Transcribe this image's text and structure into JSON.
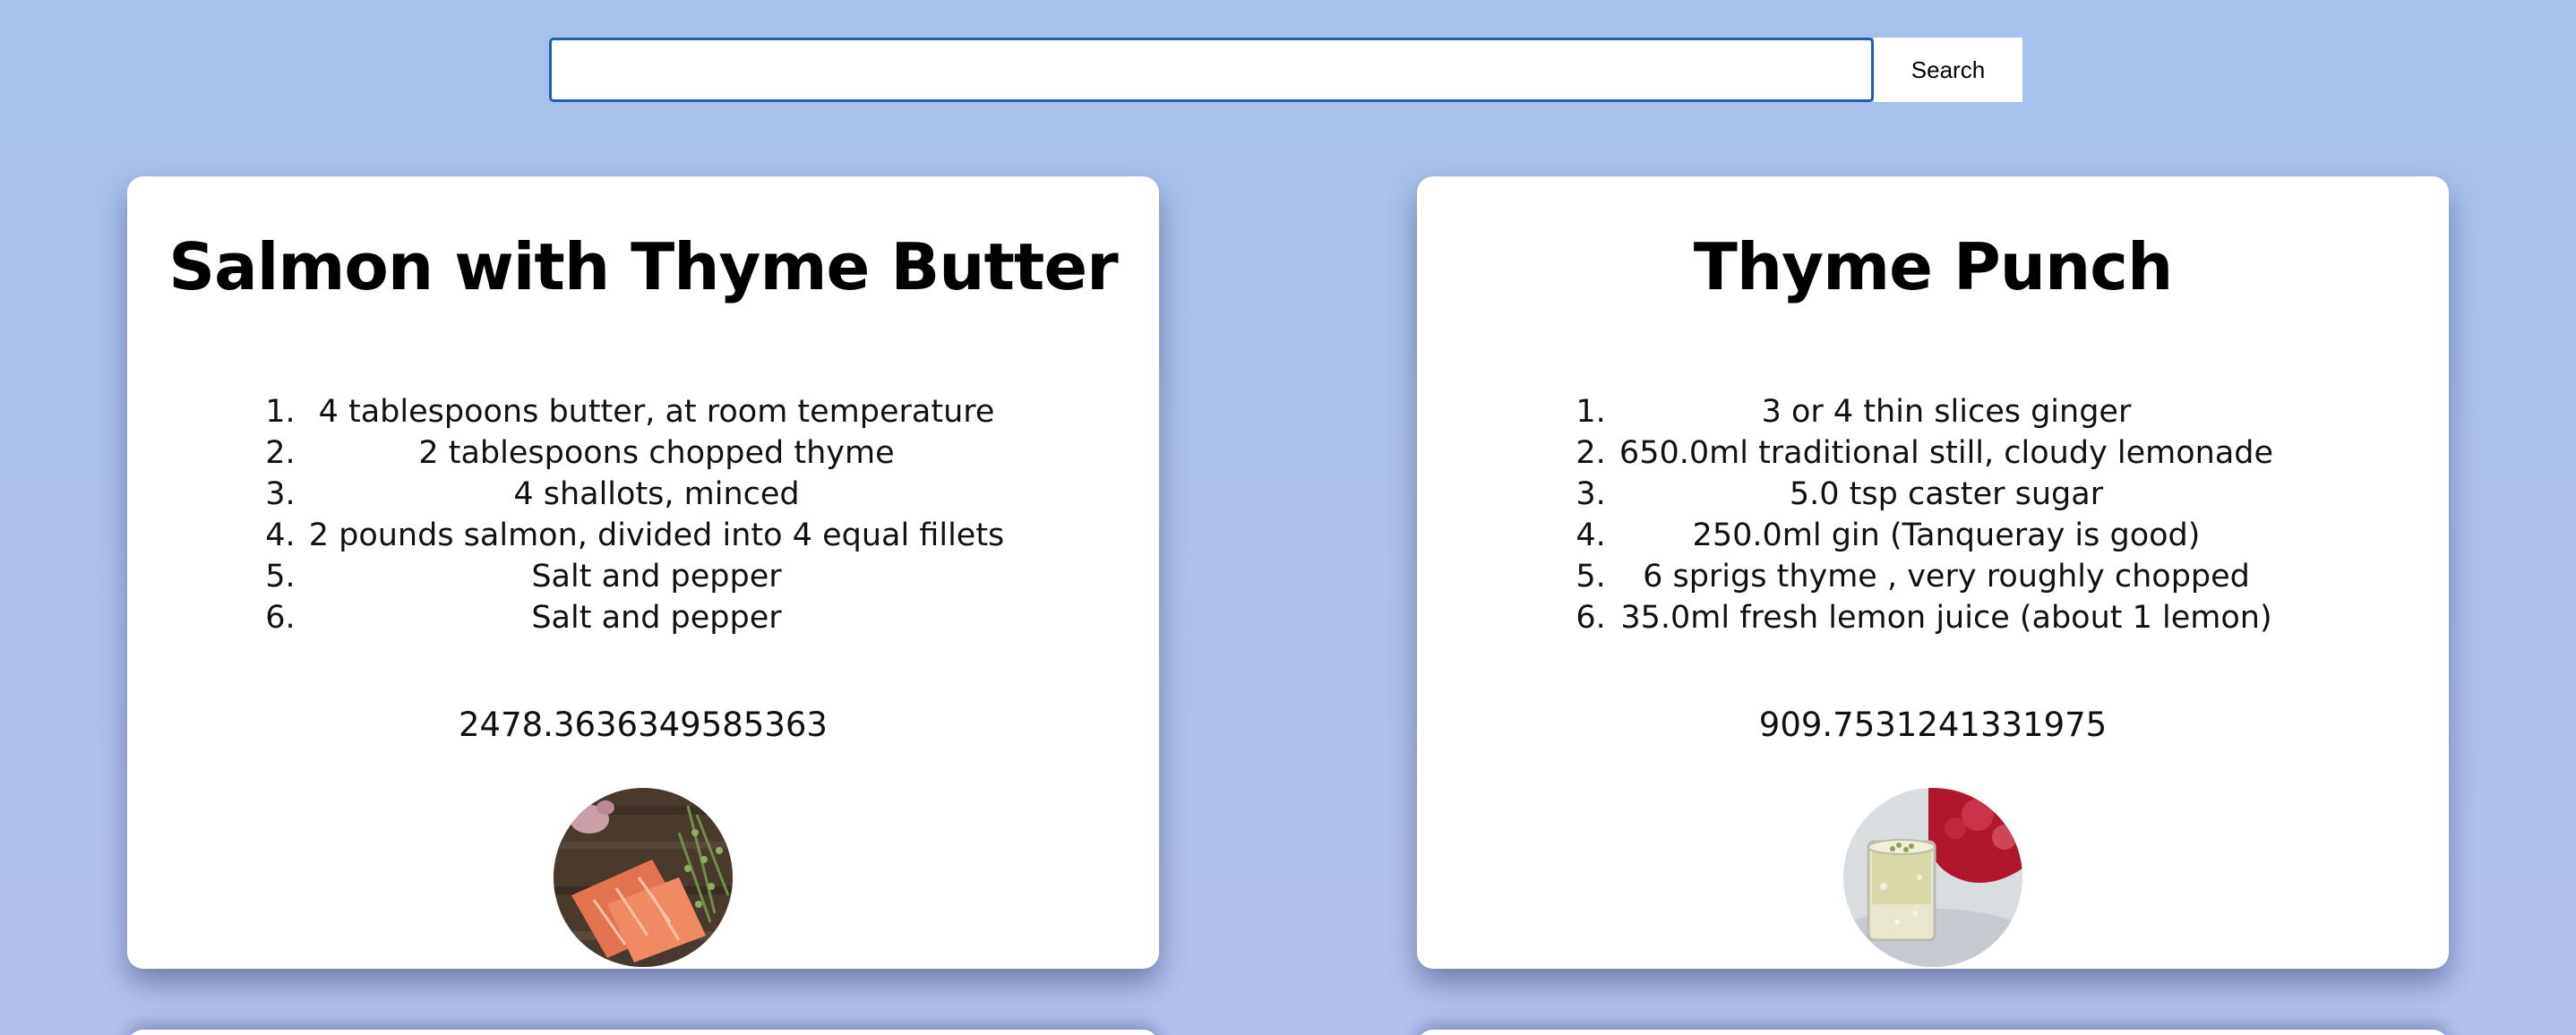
{
  "search": {
    "value": "",
    "placeholder": "",
    "button_label": "Search"
  },
  "recipes": [
    {
      "title": "Salmon with Thyme Butter",
      "ingredients": [
        "4 tablespoons butter, at room temperature",
        "2 tablespoons chopped thyme",
        "4 shallots, minced",
        "2 pounds salmon, divided into 4 equal fillets",
        "Salt and pepper",
        "Salt and pepper"
      ],
      "number": "2478.3636349585363",
      "image_icon": "salmon-photo"
    },
    {
      "title": "Thyme Punch",
      "ingredients": [
        "3 or 4 thin slices ginger",
        "650.0ml traditional still, cloudy lemonade",
        "5.0 tsp caster sugar",
        "250.0ml gin (Tanqueray is good)",
        "6 sprigs thyme , very roughly chopped",
        "35.0ml fresh lemon juice (about 1 lemon)"
      ],
      "number": "909.7531241331975",
      "image_icon": "punch-photo"
    }
  ],
  "colors": {
    "background_top": "#a7c0ec",
    "background_bottom": "#b3bfee",
    "search_border": "#1f5fae",
    "card": "#ffffff"
  }
}
